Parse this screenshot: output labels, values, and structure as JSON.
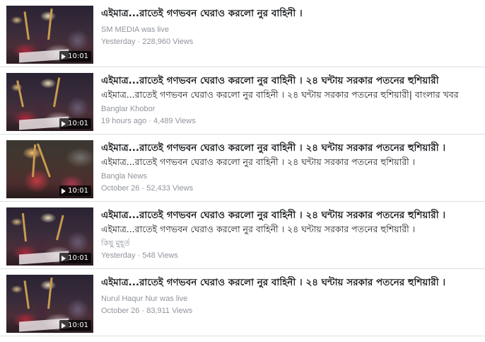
{
  "results": [
    {
      "title": "এইমাত্র...রাতেই গণভবন ঘেরাও করলো নুর বাহিনী ।",
      "description": "",
      "source": "SM MEDIA was live",
      "date": "Yesterday",
      "separator": "·",
      "views": "228,960 Views",
      "duration": "10:01",
      "thumbnail_icon": "video-thumbnail"
    },
    {
      "title": "এইমাত্র...রাতেই গণভবন ঘেরাও করলো নুর বাহিনী । ২৪ ঘন্টায় সরকার পতনের হুশিয়ারী",
      "description": "এইমাত্র...রাতেই গণভবন ঘেরাও করলো নুর বাহিনী । ২৪ ঘন্টায় সরকার পতনের হুশিয়ারী| বাংলার খবর",
      "source": "Banglar Khobor",
      "date": "19 hours ago",
      "separator": "·",
      "views": "4,489 Views",
      "duration": "10:01",
      "thumbnail_icon": "video-thumbnail"
    },
    {
      "title": "এইমাত্র...রাতেই গণভবন ঘেরাও করলো নুর বাহিনী । ২৪ ঘন্টায় সরকার পতনের হুশিয়ারী ।",
      "description": "এইমাত্র...রাতেই গণভবন ঘেরাও করলো নুর বাহিনী । ২৪ ঘন্টায় সরকার পতনের হুশিয়ারী ।",
      "source": "Bangla News",
      "date": "October 26",
      "separator": "·",
      "views": "52,433 Views",
      "duration": "10:01",
      "thumbnail_icon": "video-thumbnail"
    },
    {
      "title": "এইমাত্র...রাতেই গণভবন ঘেরাও করলো নুর বাহিনী । ২৪ ঘন্টায় সরকার পতনের হুশিয়ারী ।",
      "description": "এইমাত্র...রাতেই গণভবন ঘেরাও করলো নুর বাহিনী । ২৪ ঘন্টায় সরকার পতনের হুশিয়ারী ।",
      "source": "কিছু মুহূর্ত",
      "date": "Yesterday",
      "separator": "·",
      "views": "548 Views",
      "duration": "10:01",
      "thumbnail_icon": "video-thumbnail"
    },
    {
      "title": "এইমাত্র...রাতেই গণভবন ঘেরাও করলো নুর বাহিনী । ২৪ ঘন্টায় সরকার পতনের হুশিয়ারী ।",
      "description": "",
      "source": "Nurul Haqur Nur was live",
      "date": "October 26",
      "separator": "·",
      "views": "83,911 Views",
      "duration": "10:01",
      "thumbnail_icon": "video-thumbnail"
    }
  ],
  "colors": {
    "title": "#1c1e21",
    "meta": "#90949c",
    "divider": "#dddfe2",
    "duration_bg": "#000000"
  }
}
